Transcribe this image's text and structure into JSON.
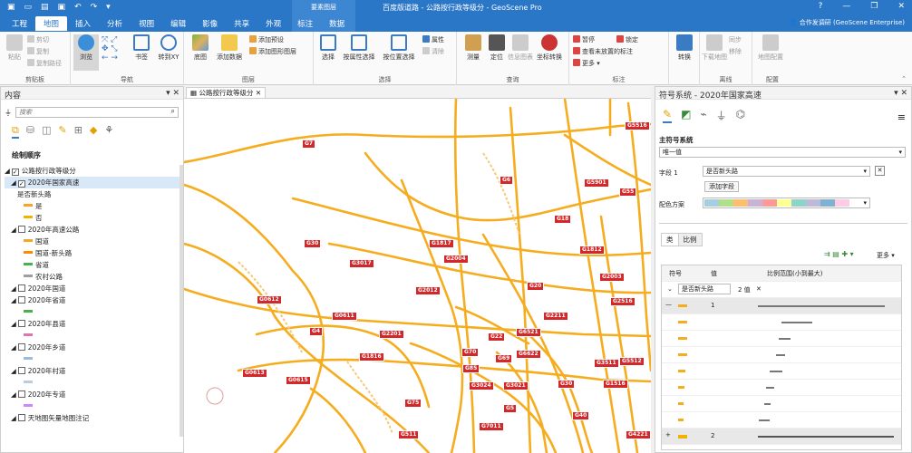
{
  "titlebar": {
    "context_tab": "要素图层",
    "window_title": "百度版道路 - 公路按行政等级分 - GeoScene Pro",
    "user": "合作发调研 (GeoScene Enterprise)"
  },
  "ribbon_tabs": [
    "工程",
    "地图",
    "插入",
    "分析",
    "视图",
    "编辑",
    "影像",
    "共享",
    "外观",
    "标注",
    "数据"
  ],
  "groups": {
    "clipboard": {
      "label": "剪贴板",
      "paste": "粘贴",
      "cut": "剪切",
      "copy": "复制",
      "copy_path": "复制路径"
    },
    "nav": {
      "label": "导航",
      "explore": "浏览",
      "bookmark": "书签",
      "goto": "转到XY"
    },
    "layer": {
      "label": "图层",
      "basemap": "底图",
      "add_data": "添加数据",
      "add_preset": "添加预设",
      "add_graphics": "添加图形图层"
    },
    "select": {
      "label": "选择",
      "select": "选择",
      "by_attr": "按属性选择",
      "by_loc": "按位置选择",
      "attributes": "属性",
      "clear": "清除"
    },
    "inquiry": {
      "label": "查询",
      "measure": "测量",
      "locate": "定位",
      "infographic": "信息图表",
      "coord": "坐标转换"
    },
    "labeling": {
      "label": "标注",
      "pause": "暂停",
      "lock": "锁定",
      "view_unplaced": "查看未放置的标注",
      "more": "更多"
    },
    "convert": {
      "label": "",
      "convert": "转换"
    },
    "offline": {
      "label": "离线",
      "download": "下载地图",
      "sync": "同步",
      "remove": "移除"
    },
    "config": {
      "label": "配置",
      "map_config": "地图配置"
    }
  },
  "contents": {
    "title": "内容",
    "search_placeholder": "搜索",
    "draw_order": "绘制顺序",
    "items": [
      {
        "label": "公路按行政等级分",
        "checked": true,
        "level": 0
      },
      {
        "label": "2020年国家高速",
        "checked": true,
        "level": 1
      },
      {
        "label": "是否新头路",
        "checked": null,
        "level": 2
      },
      {
        "label": "是",
        "swatch": "#f5a623",
        "level": 3
      },
      {
        "label": "否",
        "swatch": "#f0b400",
        "level": 3
      },
      {
        "label": "2020年高速公路",
        "checked": false,
        "level": 1
      },
      {
        "label": "国道",
        "swatch": "#f5a623",
        "level": 3
      },
      {
        "label": "国道-新头路",
        "swatch": "#ff8a00",
        "level": 3
      },
      {
        "label": "省道",
        "swatch": "#4caf50",
        "level": 3
      },
      {
        "label": "农村公路",
        "swatch": "#9e9e9e",
        "level": 3
      },
      {
        "label": "2020年国道",
        "checked": false,
        "level": 1
      },
      {
        "label": "2020年省道",
        "checked": false,
        "level": 1
      },
      {
        "label": "",
        "swatch": "#4caf50",
        "level": 3
      },
      {
        "label": "2020年县道",
        "checked": false,
        "level": 1
      },
      {
        "label": "",
        "swatch": "#d7a",
        "level": 3
      },
      {
        "label": "2020年乡道",
        "checked": false,
        "level": 1
      },
      {
        "label": "",
        "swatch": "#9bd",
        "level": 3
      },
      {
        "label": "2020年村道",
        "checked": false,
        "level": 1
      },
      {
        "label": "",
        "swatch": "#bcd",
        "level": 3
      },
      {
        "label": "2020年专道",
        "checked": false,
        "level": 1
      },
      {
        "label": "",
        "swatch": "#c8f",
        "level": 3
      },
      {
        "label": "天地图矢量地图注记",
        "checked": false,
        "level": 1
      }
    ]
  },
  "map": {
    "tab_label": "公路按行政等级分",
    "shields": [
      "G7",
      "G6",
      "G5516",
      "G5901",
      "G55",
      "G18",
      "G30",
      "G1817",
      "G3017",
      "G2004",
      "G1812",
      "G2012",
      "G0612",
      "G0611",
      "G20",
      "G2003",
      "G2516",
      "G2211",
      "G4",
      "G2201",
      "G22",
      "G6521",
      "G70",
      "G6622",
      "G1816",
      "G3511",
      "G5512",
      "G0613",
      "G0615",
      "G85",
      "G69",
      "G3024",
      "G3021",
      "G30",
      "G1516",
      "G75",
      "G5",
      "G40",
      "G7011",
      "G511",
      "G4221"
    ]
  },
  "symbology": {
    "title": "符号系统 - 2020年国家高速",
    "primary": "主符号系统",
    "method": "唯一值",
    "field1_label": "字段 1",
    "field1_value": "是否新头路",
    "add_field": "添加字段",
    "scheme_label": "配色方案",
    "tabs": [
      "类",
      "比例"
    ],
    "more": "更多",
    "col_symbol": "符号",
    "col_value": "值",
    "col_range": "比例范围(小到最大)",
    "group_field": "是否新头路",
    "group_count": "2 值",
    "rows": [
      "1",
      "",
      "",
      "",
      "",
      "",
      "",
      ""
    ],
    "row_last": "2"
  }
}
